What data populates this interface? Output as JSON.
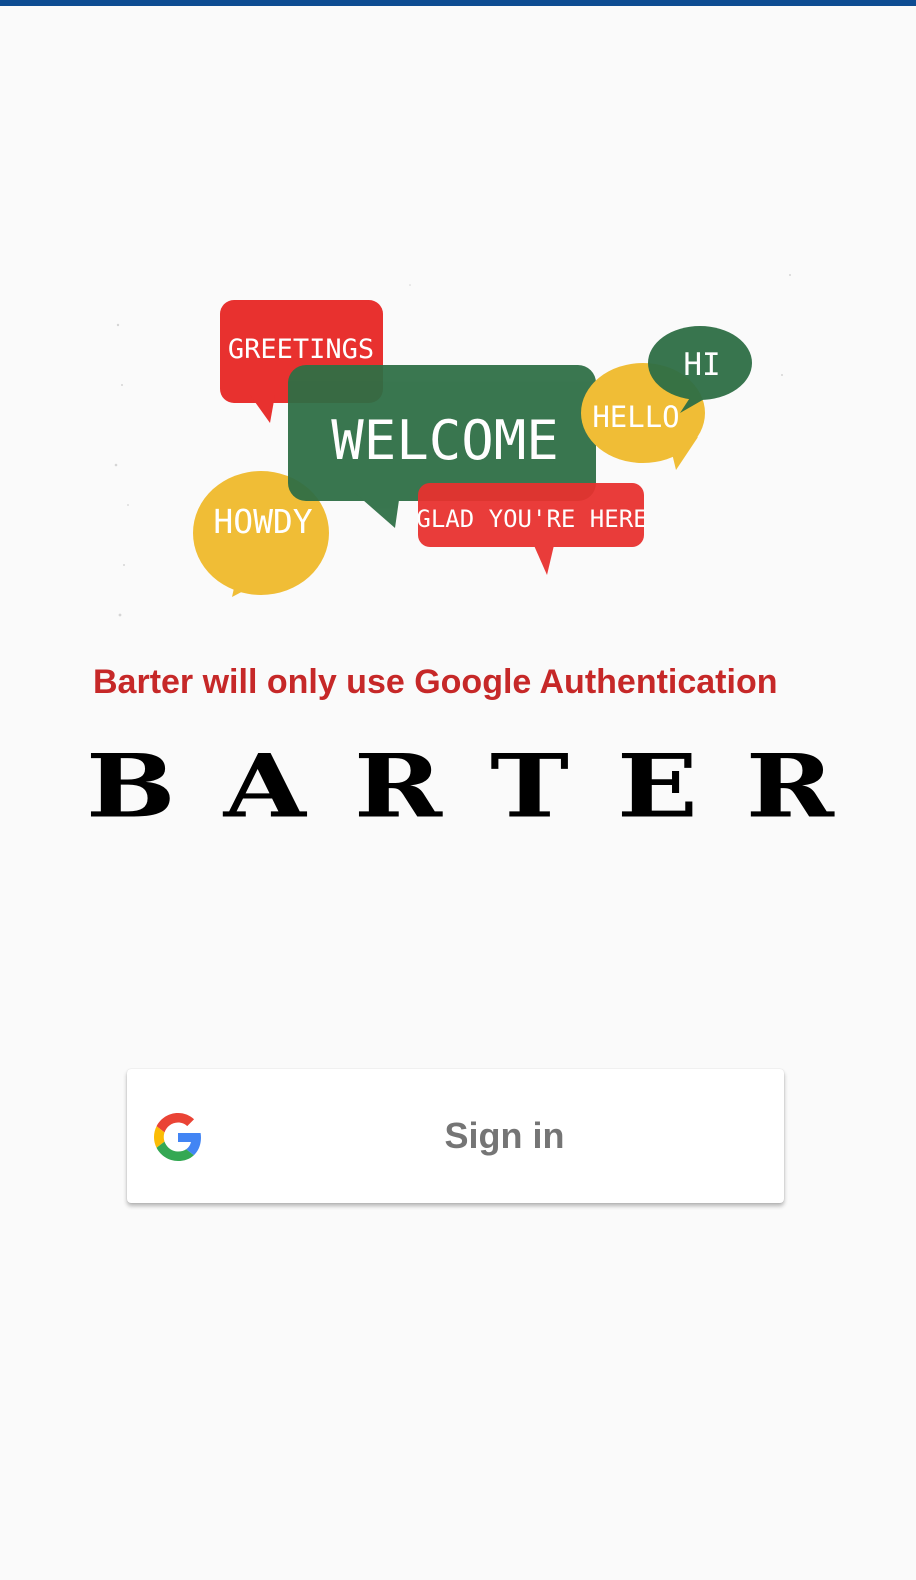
{
  "colors": {
    "top_bar": "#0d4c92",
    "background": "#fafafa",
    "auth_note": "#c62828",
    "bubble_red": "#e8312f",
    "bubble_green": "#2e6e45",
    "bubble_yellow": "#f0bd36",
    "signin_text": "#757575"
  },
  "illustration": {
    "bubbles": [
      "GREETINGS",
      "WELCOME",
      "HI",
      "HELLO",
      "HOWDY",
      "GLAD YOU'RE HERE"
    ]
  },
  "auth_note": "Barter will only use Google Authentication",
  "brand": {
    "letters": [
      "B",
      "A",
      "R",
      "T",
      "E",
      "R"
    ]
  },
  "signin": {
    "icon": "google-g-icon",
    "label": "Sign in"
  }
}
